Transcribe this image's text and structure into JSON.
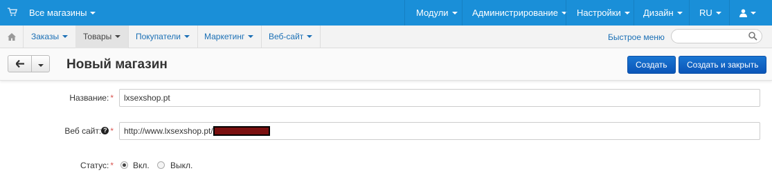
{
  "topbar": {
    "store_selector": "Все магазины",
    "menu": [
      {
        "label": "Модули"
      },
      {
        "label": "Администрирование"
      },
      {
        "label": "Настройки"
      },
      {
        "label": "Дизайн"
      },
      {
        "label": "RU"
      }
    ],
    "user_icon": "user-icon",
    "cart_icon": "cart-icon"
  },
  "subnav": {
    "home_icon": "home-icon",
    "items": [
      {
        "label": "Заказы"
      },
      {
        "label": "Товары"
      },
      {
        "label": "Покупатели"
      },
      {
        "label": "Маркетинг"
      },
      {
        "label": "Веб-сайт"
      }
    ],
    "active_item": "Товары",
    "quick_menu": "Быстрое меню",
    "search_placeholder": "",
    "search_icon": "search-icon"
  },
  "toolbar": {
    "title": "Новый магазин",
    "back_icon": "arrow-left-icon",
    "create_label": "Создать",
    "create_close_label": "Создать и закрыть"
  },
  "form": {
    "name_label": "Название:",
    "name_value": "lxsexshop.pt",
    "website_label": "Веб сайт:",
    "website_value": "http://www.lxsexshop.pt/",
    "status_label": "Статус:",
    "status_on": "Вкл.",
    "status_off": "Выкл.",
    "status_selected": "Вкл."
  },
  "colors": {
    "topbar": "#1a8fd8",
    "primary_button": "#0b55b8",
    "required": "#d9534f"
  }
}
